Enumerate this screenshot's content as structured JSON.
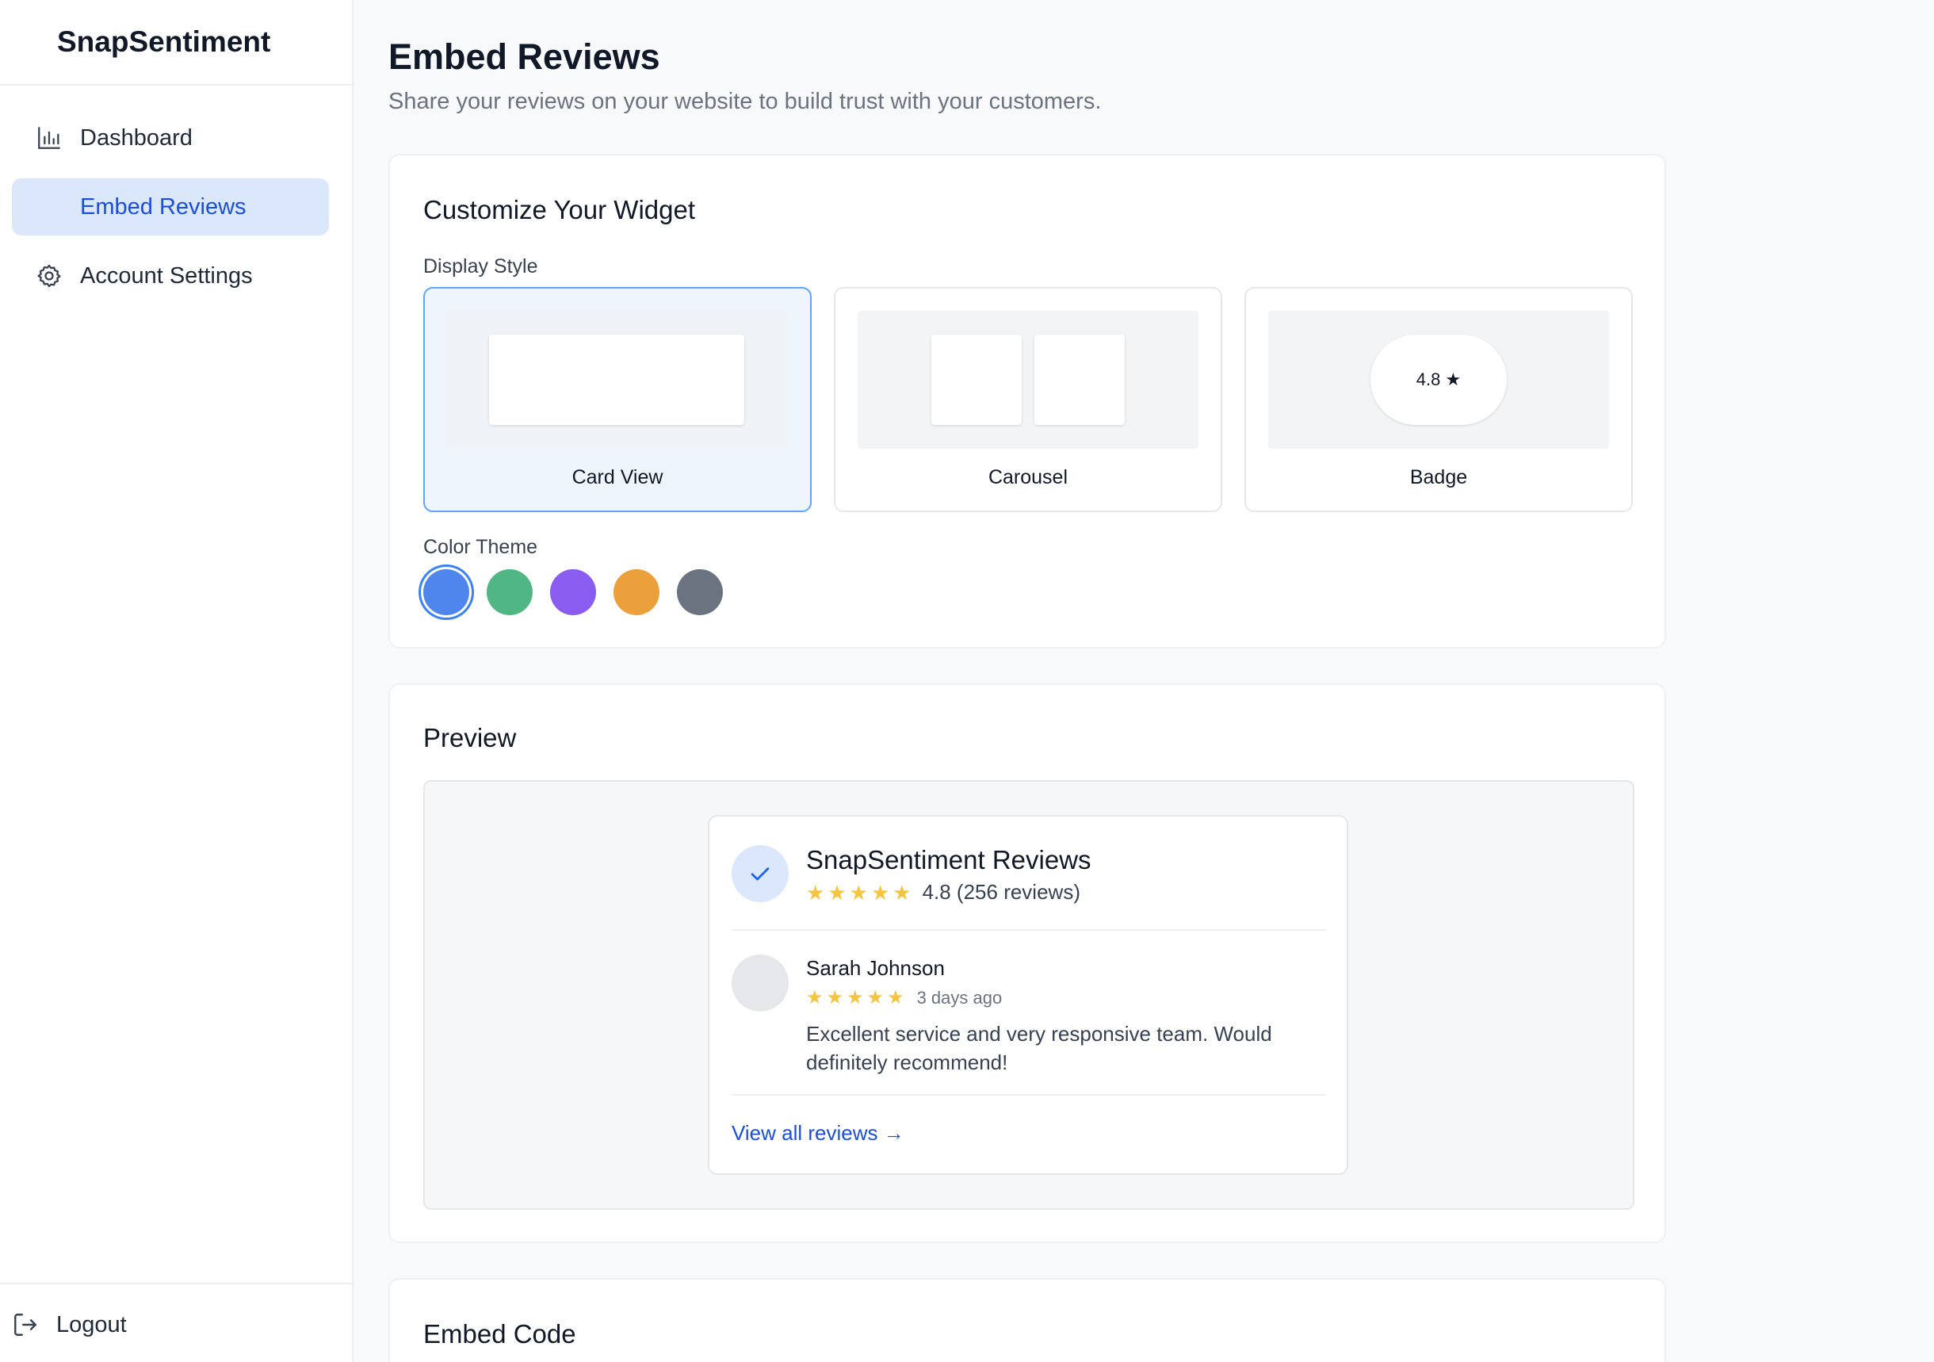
{
  "app": {
    "brand": "SnapSentiment"
  },
  "sidebar": {
    "items": [
      {
        "label": "Dashboard",
        "icon": "bar-chart-icon",
        "active": false
      },
      {
        "label": "Embed Reviews",
        "icon": "",
        "active": true
      },
      {
        "label": "Account Settings",
        "icon": "gear-icon",
        "active": false
      }
    ],
    "logout_label": "Logout"
  },
  "page": {
    "title": "Embed Reviews",
    "subtitle": "Share your reviews on your website to build trust with your customers."
  },
  "customize": {
    "title": "Customize Your Widget",
    "display_style_label": "Display Style",
    "styles": [
      {
        "label": "Card View",
        "selected": true
      },
      {
        "label": "Carousel",
        "selected": false
      },
      {
        "label": "Badge",
        "selected": false,
        "badge_text": "4.8 ★"
      }
    ],
    "color_theme_label": "Color Theme",
    "colors": [
      {
        "name": "blue",
        "hex": "#4f86ed",
        "selected": true
      },
      {
        "name": "green",
        "hex": "#50b684",
        "selected": false
      },
      {
        "name": "purple",
        "hex": "#8b5cf0",
        "selected": false
      },
      {
        "name": "orange",
        "hex": "#eba03c",
        "selected": false
      },
      {
        "name": "gray",
        "hex": "#6b7280",
        "selected": false
      }
    ]
  },
  "preview": {
    "title": "Preview",
    "widget": {
      "title": "SnapSentiment Reviews",
      "rating_text": "4.8 (256 reviews)",
      "stars": 5,
      "review": {
        "author": "Sarah Johnson",
        "stars": 5,
        "date": "3 days ago",
        "text": "Excellent service and very responsive team. Would definitely recommend!"
      },
      "view_all_label": "View all reviews →"
    }
  },
  "embed": {
    "title": "Embed Code"
  },
  "colors": {
    "accent": "#1d4ed8",
    "active_bg": "#dbe7fb",
    "star": "#f5c542"
  }
}
